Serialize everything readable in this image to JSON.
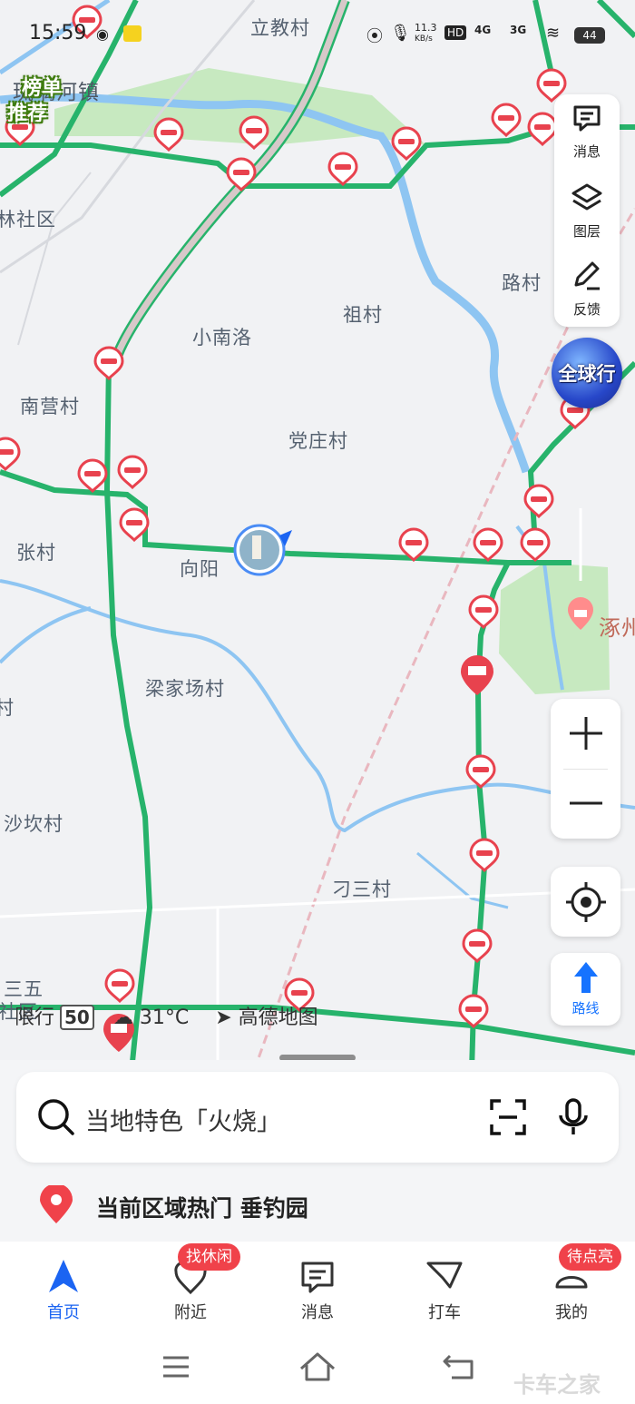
{
  "status_bar": {
    "time": "15:59",
    "net_speed_value": "11.3",
    "net_speed_unit": "KB/s",
    "hd": "HD",
    "sig1": "4G",
    "sig2": "3G",
    "battery": "44"
  },
  "map": {
    "places": [
      {
        "name": "立教村",
        "class": "place"
      },
      {
        "name": "琉璃河镇",
        "class": "place town"
      },
      {
        "name": "林社区",
        "class": "place"
      },
      {
        "name": "祖村",
        "class": "place"
      },
      {
        "name": "路村",
        "class": "place"
      },
      {
        "name": "小南洛",
        "class": "place"
      },
      {
        "name": "南营村",
        "class": "place"
      },
      {
        "name": "党庄村",
        "class": "place"
      },
      {
        "name": "张村",
        "class": "place"
      },
      {
        "name": "向阳",
        "class": "place"
      },
      {
        "name": "梁家场村",
        "class": "place"
      },
      {
        "name": "村",
        "class": "place"
      },
      {
        "name": "沙坎村",
        "class": "place"
      },
      {
        "name": "刁三村",
        "class": "place"
      },
      {
        "name": "三五",
        "class": "place"
      },
      {
        "name": "社区",
        "class": "place"
      }
    ],
    "poi_label": "涿州",
    "rank_badge_line1": "榜单",
    "rank_badge_line2": "推荐",
    "globe_label": "全球行",
    "info": {
      "limit_label": "限行",
      "limit_value": "50",
      "temperature": "31°C",
      "brand": "高德地图"
    }
  },
  "right_panel": {
    "message": "消息",
    "layers": "图层",
    "feedback": "反馈"
  },
  "route_button": "路线",
  "search": {
    "placeholder": "当地特色「火烧」"
  },
  "hot_area": {
    "text": "当前区域热门 垂钓园"
  },
  "tabs": [
    {
      "label": "首页",
      "icon": "navigation-arrow-icon",
      "active": true
    },
    {
      "label": "附近",
      "icon": "heart-location-icon",
      "badge": "找休闲"
    },
    {
      "label": "消息",
      "icon": "message-icon"
    },
    {
      "label": "打车",
      "icon": "taxi-icon"
    },
    {
      "label": "我的",
      "icon": "profile-icon",
      "badge": "待点亮"
    }
  ],
  "watermark": "卡车之家",
  "colors": {
    "accent_blue": "#1b64f2",
    "road_green": "#27b36b",
    "closure_red": "#e8424e",
    "badge_red": "#f0424a"
  }
}
